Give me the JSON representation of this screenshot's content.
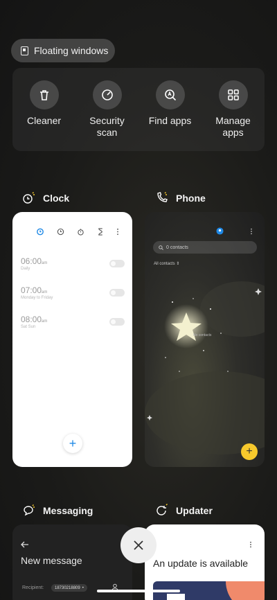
{
  "floating": {
    "label": "Floating windows"
  },
  "tools": [
    {
      "label": "Cleaner",
      "icon": "trash-icon"
    },
    {
      "label": "Security\nscan",
      "icon": "security-scan-icon"
    },
    {
      "label": "Find apps",
      "icon": "find-apps-icon"
    },
    {
      "label": "Manage\napps",
      "icon": "grid-icon"
    }
  ],
  "cards": {
    "clock": {
      "title": "Clock",
      "alarms": [
        {
          "time": "06:00",
          "ampm": "am",
          "days": "Daily"
        },
        {
          "time": "07:00",
          "ampm": "am",
          "days": "Monday to Friday"
        },
        {
          "time": "08:00",
          "ampm": "am",
          "days": "Sat Sun"
        }
      ],
      "fab": "+"
    },
    "phone": {
      "title": "Phone",
      "search_placeholder": "0 contacts",
      "filter": "All contacts",
      "empty": "No contacts",
      "fab": "+"
    },
    "messaging": {
      "title": "Messaging",
      "heading": "New message",
      "recipient_label": "Recipient:",
      "recipient_value": "18730218809"
    },
    "updater": {
      "title": "Updater",
      "heading": "An update is available"
    }
  },
  "colors": {
    "accent_blue": "#1e88e5",
    "fab_yellow": "#f7c92c"
  }
}
